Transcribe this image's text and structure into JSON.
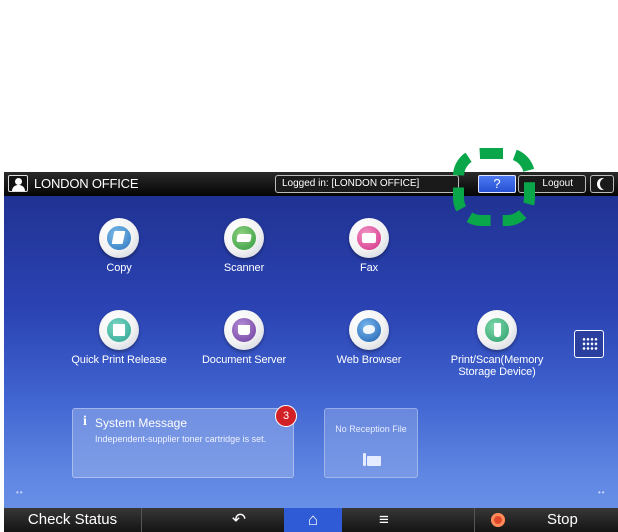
{
  "topbar": {
    "office_name": "LONDON OFFICE",
    "login_status": "Logged in: [LONDON OFFICE]",
    "help_label": "?",
    "logout_label": "Logout"
  },
  "apps": [
    {
      "label": "Copy",
      "icon": "copy-icon"
    },
    {
      "label": "Scanner",
      "icon": "scanner-icon"
    },
    {
      "label": "Fax",
      "icon": "fax-icon"
    },
    {
      "label": "Quick Print Release",
      "icon": "quick-print-release-icon"
    },
    {
      "label": "Document Server",
      "icon": "document-server-icon"
    },
    {
      "label": "Web Browser",
      "icon": "web-browser-icon"
    },
    {
      "label": "Print/Scan(Memory Storage Device)",
      "icon": "usb-storage-icon"
    }
  ],
  "system_message": {
    "title": "System Message",
    "text": "Independent-supplier toner cartridge is set.",
    "count": "3"
  },
  "no_reception": {
    "label": "No Reception File"
  },
  "bottombar": {
    "check_status": "Check Status",
    "back_glyph": "↶",
    "home_glyph": "⌂",
    "menu_glyph": "≡",
    "stop_label": "Stop"
  },
  "colors": {
    "panel_top": "#1e2f8c",
    "panel_bottom": "#6e96ea",
    "help_button": "#3562e3",
    "home_button": "#2f5bd6",
    "highlight": "#0aa64a",
    "badge": "#d22027"
  }
}
